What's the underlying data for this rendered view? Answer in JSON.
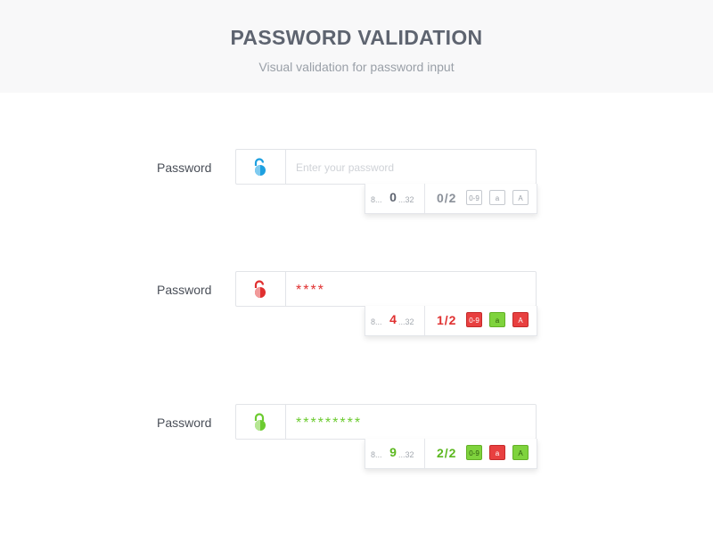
{
  "header": {
    "title": "PASSWORD VALIDATION",
    "subtitle": "Visual validation for password input"
  },
  "colors": {
    "neutral": "#1ea0e0",
    "error": "#e03030",
    "success": "#6ccb30"
  },
  "examples": [
    {
      "label": "Password",
      "lock_icon": "unlocked-padlock-icon",
      "lock_color": "#1ea0e0",
      "input_value": "",
      "input_placeholder": "Enter your password",
      "length_min": "8",
      "length_count": "0",
      "length_max": "32",
      "length_count_color": "#5e6470",
      "score": "0/2",
      "score_color": "#8a9099",
      "badges": [
        {
          "text": "0-9",
          "state": "neutral"
        },
        {
          "text": "a",
          "state": "neutral"
        },
        {
          "text": "A",
          "state": "neutral"
        }
      ]
    },
    {
      "label": "Password",
      "lock_icon": "unlocked-padlock-icon",
      "lock_color": "#e03030",
      "input_value": "****",
      "input_placeholder": "",
      "length_min": "8",
      "length_count": "4",
      "length_max": "32",
      "length_count_color": "#e03030",
      "score": "1/2",
      "score_color": "#e03030",
      "badges": [
        {
          "text": "0-9",
          "state": "bad"
        },
        {
          "text": "a",
          "state": "ok"
        },
        {
          "text": "A",
          "state": "bad"
        }
      ]
    },
    {
      "label": "Password",
      "lock_icon": "locked-padlock-icon",
      "lock_color": "#6ccb30",
      "input_value": "*********",
      "input_placeholder": "",
      "length_min": "8",
      "length_count": "9",
      "length_max": "32",
      "length_count_color": "#5cb820",
      "score": "2/2",
      "score_color": "#5cb820",
      "badges": [
        {
          "text": "0-9",
          "state": "ok"
        },
        {
          "text": "a",
          "state": "bad"
        },
        {
          "text": "A",
          "state": "ok"
        }
      ]
    }
  ]
}
